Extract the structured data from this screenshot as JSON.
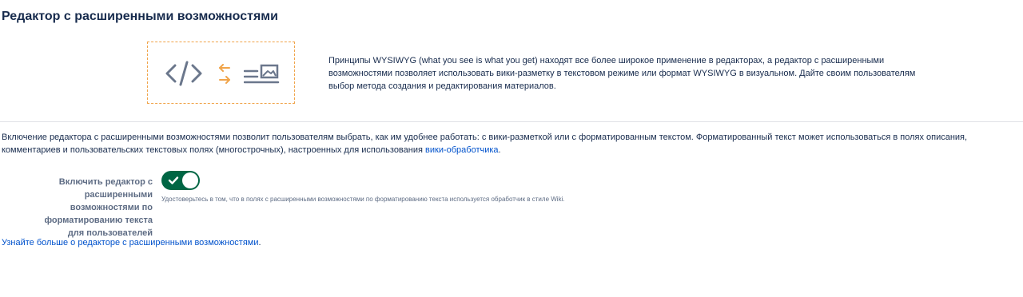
{
  "header": {
    "title": "Редактор с расширенными возможностями"
  },
  "illustration": {
    "icons": [
      "code-brackets-icon",
      "swap-arrows-icon",
      "document-image-icon"
    ],
    "border_color": "#f0a44a",
    "arrow_color": "#f0a44a",
    "icon_color": "#6b778c"
  },
  "intro": {
    "text": "Принципы WYSIWYG (what you see is what you get) находят все более широкое применение в редакторах, а редактор с расширенными возможностями позволяет использовать вики-разметку в текстовом режиме или формат WYSIWYG в визуальном. Дайте своим пользователям выбор метода создания и редактирования материалов."
  },
  "description": {
    "text": "Включение редактора с расширенными возможностями позволит пользователям выбрать, как им удобнее работать: с вики-разметкой или с форматированным текстом. Форматированный текст может использоваться в полях описания, комментариев и пользовательских текстовых полях (многострочных), настроенных для использования ",
    "link_text": "вики-обработчика",
    "suffix": "."
  },
  "setting": {
    "label": "Включить редактор с расширенными возможностями по форматированию текста для пользователей",
    "toggle_on": true,
    "toggle_color": "#006644",
    "hint": "Удостоверьтесь в том, что в полях с расширенными возможностями по форматированию текста используется обработчик в стиле Wiki."
  },
  "footer": {
    "learn_more_link": "Узнайте больше о редакторе с расширенными возможностями",
    "learn_more_suffix": "."
  },
  "colors": {
    "link": "#0052cc",
    "text": "#172b4d",
    "muted": "#5e6c84"
  }
}
